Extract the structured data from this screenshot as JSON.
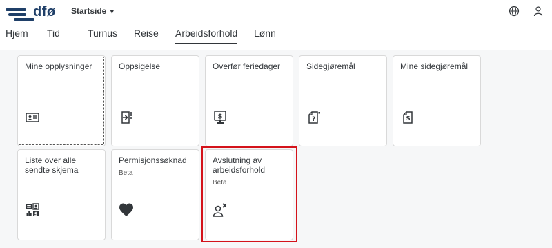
{
  "header": {
    "logo_text": "dfø",
    "app_menu_label": "Startside",
    "icons": [
      "globe-icon",
      "user-icon"
    ]
  },
  "tabs": [
    {
      "label": "Hjem",
      "active": false
    },
    {
      "label": "Tid",
      "active": false
    },
    {
      "label": "Turnus",
      "active": false
    },
    {
      "label": "Reise",
      "active": false
    },
    {
      "label": "Arbeidsforhold",
      "active": true
    },
    {
      "label": "Lønn",
      "active": false
    }
  ],
  "tiles": [
    {
      "title": "Mine opplysninger",
      "subtitle": "",
      "icon": "id-card-icon"
    },
    {
      "title": "Oppsigelse",
      "subtitle": "",
      "icon": "exit-document-icon"
    },
    {
      "title": "Overfør feriedager",
      "subtitle": "",
      "icon": "monitor-dollar-icon"
    },
    {
      "title": "Sidegjøremål",
      "subtitle": "",
      "icon": "document-question-icon"
    },
    {
      "title": "Mine sidegjøremål",
      "subtitle": "",
      "icon": "document-dollar-icon"
    },
    {
      "title": "Liste over alle sendte skjema",
      "subtitle": "",
      "icon": "dashboard-grid-icon"
    },
    {
      "title": "Permisjonssøknad",
      "subtitle": "Beta",
      "icon": "heart-icon"
    },
    {
      "title": "Avslutning av arbeidsforhold",
      "subtitle": "Beta",
      "icon": "user-remove-icon"
    }
  ],
  "colors": {
    "brand": "#1f3f68",
    "highlight": "#d4131b",
    "text": "#32363a"
  }
}
